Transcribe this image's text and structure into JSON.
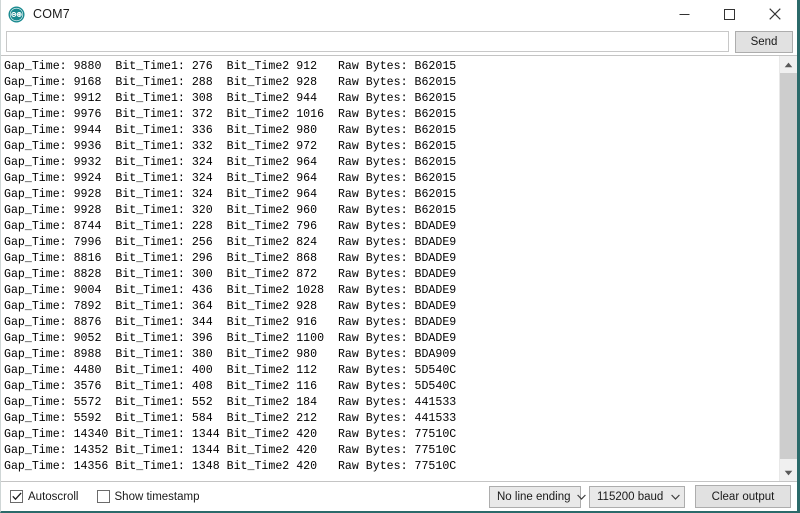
{
  "window": {
    "title": "COM7",
    "app_icon": "arduino-logo-icon",
    "controls": {
      "minimize": "minimize-icon",
      "maximize": "maximize-icon",
      "close": "close-icon"
    }
  },
  "send_bar": {
    "input_value": "",
    "input_placeholder": "",
    "send_label": "Send"
  },
  "console": {
    "lines": [
      "Gap_Time: 9880\tBit_Time1: 276\tBit_Time2 912\tRaw Bytes: B62015",
      "Gap_Time: 9168\tBit_Time1: 288\tBit_Time2 928\tRaw Bytes: B62015",
      "Gap_Time: 9912\tBit_Time1: 308\tBit_Time2 944\tRaw Bytes: B62015",
      "Gap_Time: 9976\tBit_Time1: 372\tBit_Time2 1016\tRaw Bytes: B62015",
      "Gap_Time: 9944\tBit_Time1: 336\tBit_Time2 980\tRaw Bytes: B62015",
      "Gap_Time: 9936\tBit_Time1: 332\tBit_Time2 972\tRaw Bytes: B62015",
      "Gap_Time: 9932\tBit_Time1: 324\tBit_Time2 964\tRaw Bytes: B62015",
      "Gap_Time: 9924\tBit_Time1: 324\tBit_Time2 964\tRaw Bytes: B62015",
      "Gap_Time: 9928\tBit_Time1: 324\tBit_Time2 964\tRaw Bytes: B62015",
      "Gap_Time: 9928\tBit_Time1: 320\tBit_Time2 960\tRaw Bytes: B62015",
      "Gap_Time: 8744\tBit_Time1: 228\tBit_Time2 796\tRaw Bytes: BDADE9",
      "Gap_Time: 7996\tBit_Time1: 256\tBit_Time2 824\tRaw Bytes: BDADE9",
      "Gap_Time: 8816\tBit_Time1: 296\tBit_Time2 868\tRaw Bytes: BDADE9",
      "Gap_Time: 8828\tBit_Time1: 300\tBit_Time2 872\tRaw Bytes: BDADE9",
      "Gap_Time: 9004\tBit_Time1: 436\tBit_Time2 1028\tRaw Bytes: BDADE9",
      "Gap_Time: 7892\tBit_Time1: 364\tBit_Time2 928\tRaw Bytes: BDADE9",
      "Gap_Time: 8876\tBit_Time1: 344\tBit_Time2 916\tRaw Bytes: BDADE9",
      "Gap_Time: 9052\tBit_Time1: 396\tBit_Time2 1100\tRaw Bytes: BDADE9",
      "Gap_Time: 8988\tBit_Time1: 380\tBit_Time2 980\tRaw Bytes: BDA909",
      "Gap_Time: 4480\tBit_Time1: 400\tBit_Time2 112\tRaw Bytes: 5D540C",
      "Gap_Time: 3576\tBit_Time1: 408\tBit_Time2 116\tRaw Bytes: 5D540C",
      "Gap_Time: 5572\tBit_Time1: 552\tBit_Time2 184\tRaw Bytes: 441533",
      "Gap_Time: 5592\tBit_Time1: 584\tBit_Time2 212\tRaw Bytes: 441533",
      "Gap_Time: 14340\tBit_Time1: 1344\tBit_Time2 420\tRaw Bytes: 77510C",
      "Gap_Time: 14352\tBit_Time1: 1344\tBit_Time2 420\tRaw Bytes: 77510C",
      "Gap_Time: 14356\tBit_Time1: 1348\tBit_Time2 420\tRaw Bytes: 77510C"
    ]
  },
  "scrollbar": {
    "up_arrow": "scroll-up-icon",
    "down_arrow": "scroll-down-icon"
  },
  "status_bar": {
    "autoscroll_label": "Autoscroll",
    "autoscroll_checked": true,
    "show_timestamp_label": "Show timestamp",
    "show_timestamp_checked": false,
    "line_ending_value": "No line ending",
    "baud_value": "115200 baud",
    "clear_output_label": "Clear output"
  },
  "colors": {
    "accent_border": "#2b6a6a",
    "logo_teal": "#1a8a8f",
    "console_bg": "#ffffff",
    "console_text": "#000000",
    "scrollbar_thumb": "#cdcdcd",
    "button_face": "#e1e1e1"
  }
}
